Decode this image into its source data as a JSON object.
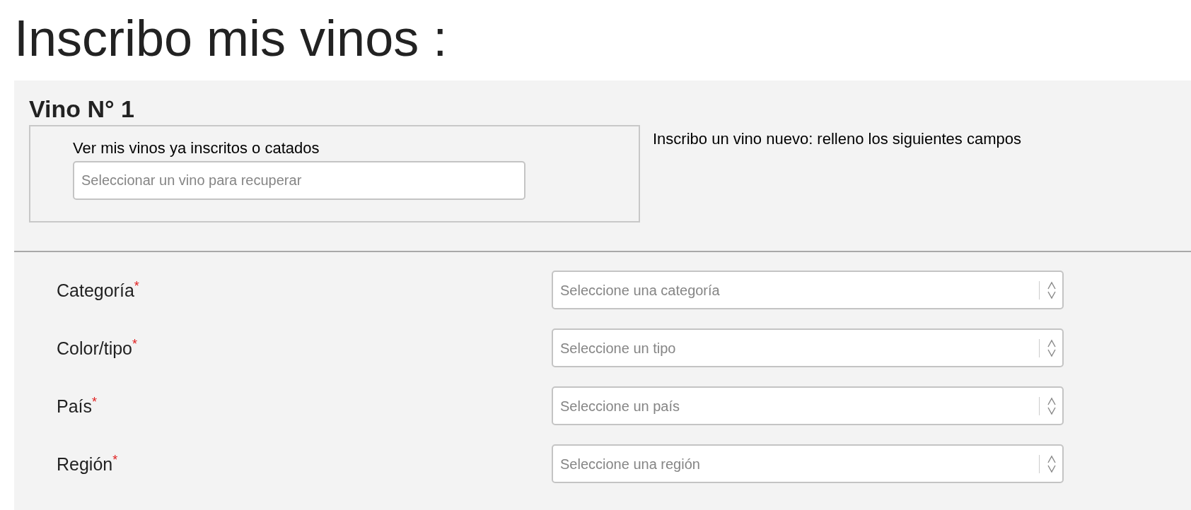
{
  "title": "Inscribo mis vinos :",
  "wine": {
    "heading": "Vino N° 1",
    "lookup": {
      "label": "Ver mis vinos ya inscritos o catados",
      "placeholder": "Seleccionar un vino para recuperar"
    },
    "new_wine_note": "Inscribo un vino nuevo: relleno los siguientes campos",
    "fields": [
      {
        "label": "Categoría",
        "required_mark": "*",
        "placeholder": "Seleccione una categoría"
      },
      {
        "label": "Color/tipo",
        "required_mark": "*",
        "placeholder": "Seleccione un tipo"
      },
      {
        "label": "País",
        "required_mark": "*",
        "placeholder": "Seleccione un país"
      },
      {
        "label": "Región",
        "required_mark": "*",
        "placeholder": "Seleccione una región"
      }
    ]
  }
}
